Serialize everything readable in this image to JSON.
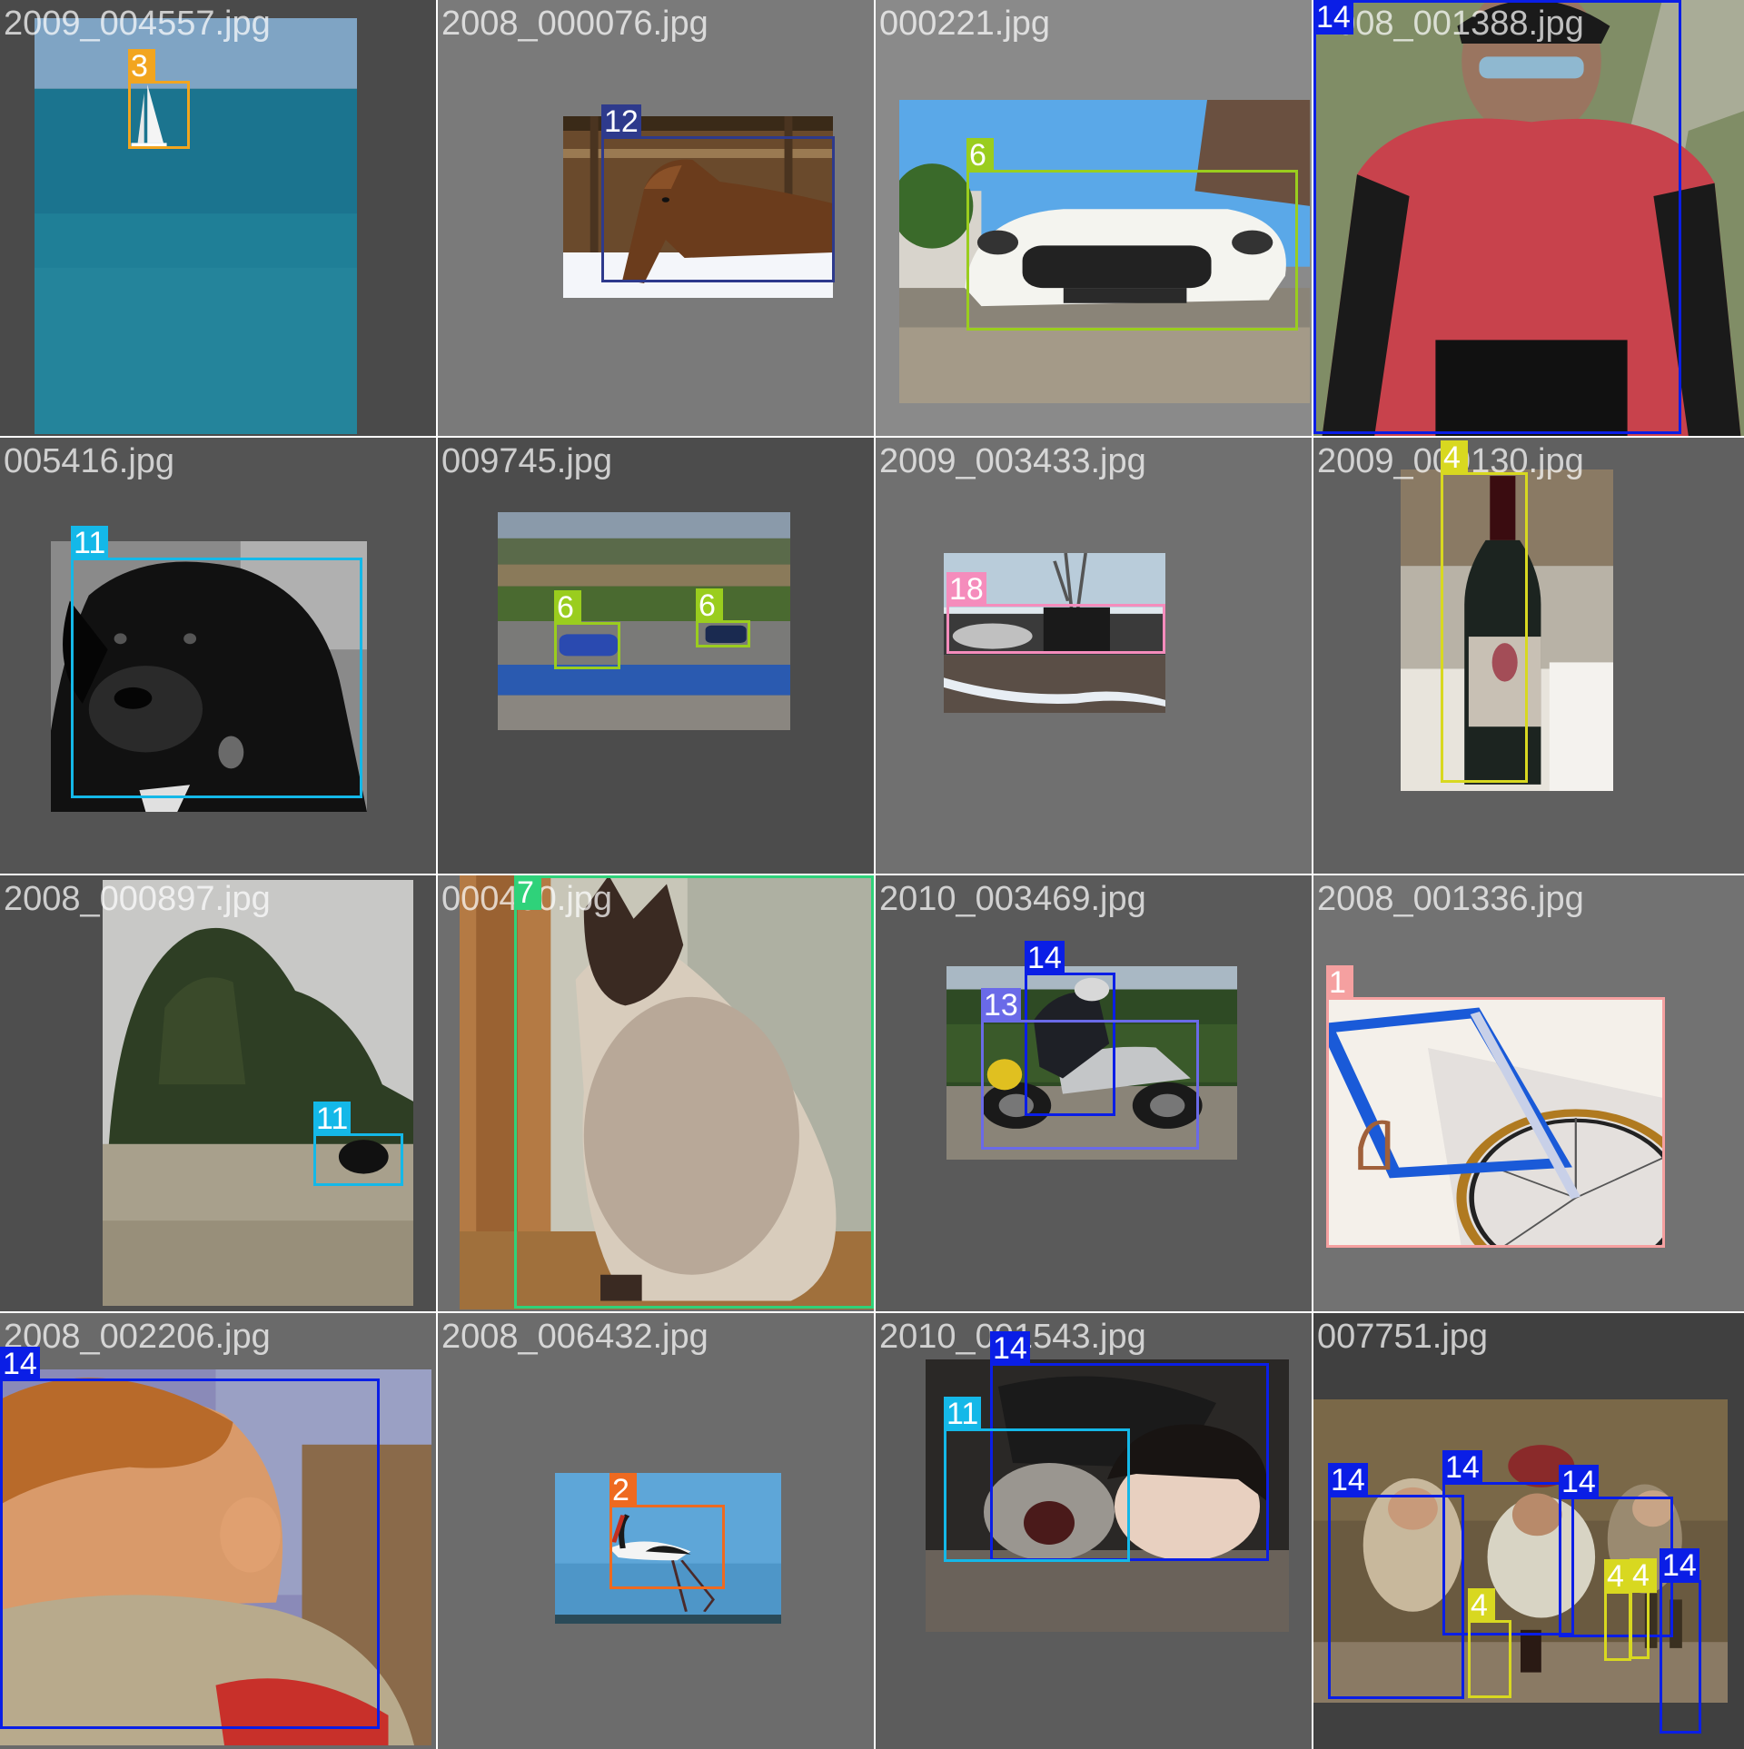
{
  "class_colors": {
    "1": "#f5a0a0",
    "2": "#ee6a20",
    "3": "#f2a51f",
    "4": "#d8d820",
    "6": "#9acd1e",
    "7": "#2fd27a",
    "11": "#14b8e8",
    "12": "#2e3a8c",
    "13": "#6a6ae8",
    "14": "#0a1ee6",
    "18": "#f58cbc"
  },
  "tiles": [
    {
      "filename": "2009_004557.jpg",
      "bg": "#4a4a4a",
      "scene": "sea",
      "boxes": [
        {
          "label": "3"
        }
      ]
    },
    {
      "filename": "2008_000076.jpg",
      "bg": "#7a7a7a",
      "scene": "horse",
      "boxes": [
        {
          "label": "12"
        }
      ]
    },
    {
      "filename": "000221.jpg",
      "bg": "#8a8a8a",
      "scene": "car",
      "boxes": [
        {
          "label": "6"
        }
      ]
    },
    {
      "filename": "2008_001388.jpg",
      "bg": "#6a6a6a",
      "scene": "cyclist",
      "boxes": [
        {
          "label": "14"
        }
      ]
    },
    {
      "filename": "005416.jpg",
      "bg": "#545454",
      "scene": "dog-bw",
      "boxes": [
        {
          "label": "11"
        }
      ]
    },
    {
      "filename": "009745.jpg",
      "bg": "#4c4c4c",
      "scene": "racetrack",
      "boxes": [
        {
          "label": "6"
        },
        {
          "label": "6"
        }
      ]
    },
    {
      "filename": "2009_003433.jpg",
      "bg": "#707070",
      "scene": "train",
      "boxes": [
        {
          "label": "18"
        }
      ]
    },
    {
      "filename": "2009_000130.jpg",
      "bg": "#606060",
      "scene": "bottle",
      "boxes": [
        {
          "label": "4"
        }
      ]
    },
    {
      "filename": "2008_000897.jpg",
      "bg": "#4e4e4e",
      "scene": "field",
      "boxes": [
        {
          "label": "11"
        }
      ]
    },
    {
      "filename": "000400.jpg",
      "bg": "#6e6e6e",
      "scene": "cat",
      "boxes": [
        {
          "label": "7"
        }
      ]
    },
    {
      "filename": "2010_003469.jpg",
      "bg": "#5a5a5a",
      "scene": "motorbike",
      "boxes": [
        {
          "label": "14"
        },
        {
          "label": "13"
        }
      ]
    },
    {
      "filename": "2008_001336.jpg",
      "bg": "#727272",
      "scene": "bicycle",
      "boxes": [
        {
          "label": "1"
        }
      ]
    },
    {
      "filename": "2008_002206.jpg",
      "bg": "#6a6a6a",
      "scene": "child",
      "boxes": [
        {
          "label": "14"
        }
      ]
    },
    {
      "filename": "2008_006432.jpg",
      "bg": "#6c6c6c",
      "scene": "stork",
      "boxes": [
        {
          "label": "2"
        }
      ]
    },
    {
      "filename": "2010_001543.jpg",
      "bg": "#5c5c5c",
      "scene": "dog-woman",
      "boxes": [
        {
          "label": "14"
        },
        {
          "label": "11"
        }
      ]
    },
    {
      "filename": "007751.jpg",
      "bg": "#404040",
      "scene": "dinner",
      "boxes": [
        {
          "label": "14"
        },
        {
          "label": "14"
        },
        {
          "label": "14"
        },
        {
          "label": "14"
        },
        {
          "label": "4"
        },
        {
          "label": "4"
        },
        {
          "label": "4"
        }
      ]
    }
  ]
}
